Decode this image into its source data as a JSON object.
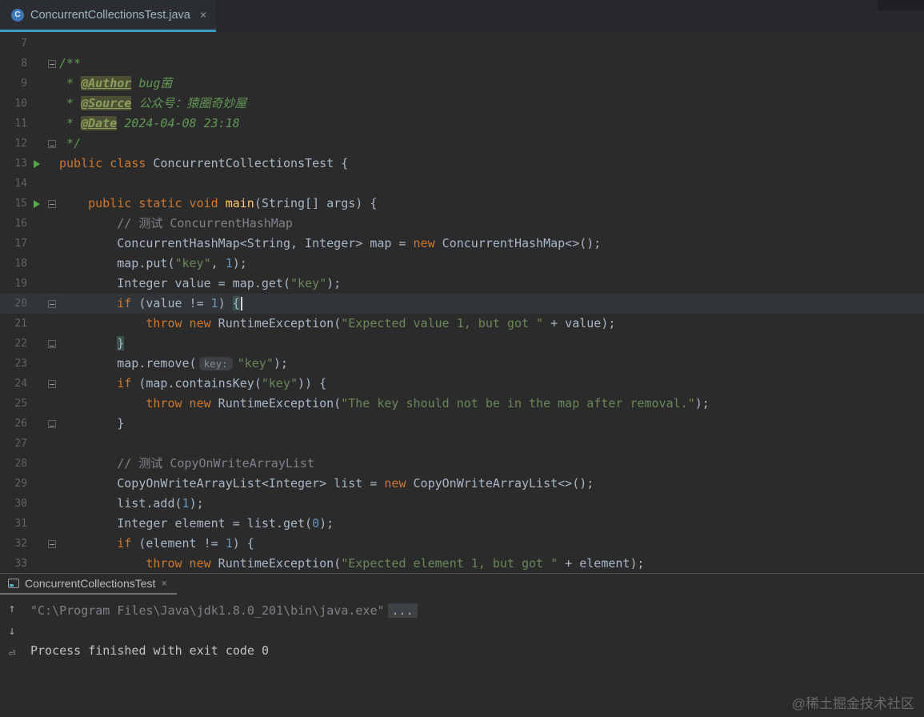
{
  "editor": {
    "tab": {
      "icon": "C",
      "label": "ConcurrentCollectionsTest.java",
      "close": "×"
    },
    "lines": [
      {
        "n": "7",
        "g": "",
        "seg": []
      },
      {
        "n": "8",
        "g": "fold",
        "seg": [
          {
            "s": "d",
            "t": "/**"
          }
        ]
      },
      {
        "n": "9",
        "g": "",
        "seg": [
          {
            "s": "d",
            "t": " * "
          },
          {
            "s": "t",
            "t": "@Author"
          },
          {
            "s": "v",
            "t": " bug菌"
          }
        ]
      },
      {
        "n": "10",
        "g": "",
        "seg": [
          {
            "s": "d",
            "t": " * "
          },
          {
            "s": "t",
            "t": "@Source"
          },
          {
            "s": "v",
            "t": " 公众号：猿圈奇妙屋"
          }
        ]
      },
      {
        "n": "11",
        "g": "",
        "seg": [
          {
            "s": "d",
            "t": " * "
          },
          {
            "s": "t",
            "t": "@Date"
          },
          {
            "s": "v",
            "t": " 2024-04-08 23:18"
          }
        ]
      },
      {
        "n": "12",
        "g": "foldend",
        "seg": [
          {
            "s": "d",
            "t": " */"
          }
        ]
      },
      {
        "n": "13",
        "g": "run",
        "seg": [
          {
            "s": "k",
            "t": "public class "
          },
          {
            "s": "p",
            "t": "ConcurrentCollectionsTest {"
          }
        ]
      },
      {
        "n": "14",
        "g": "",
        "seg": []
      },
      {
        "n": "15",
        "g": "runfold",
        "seg": [
          {
            "s": "p",
            "t": "    "
          },
          {
            "s": "k",
            "t": "public static void "
          },
          {
            "s": "m",
            "t": "main"
          },
          {
            "s": "p",
            "t": "(String[] args) {"
          }
        ]
      },
      {
        "n": "16",
        "g": "",
        "seg": [
          {
            "s": "p",
            "t": "        "
          },
          {
            "s": "c",
            "t": "// 测试 ConcurrentHashMap"
          }
        ]
      },
      {
        "n": "17",
        "g": "",
        "seg": [
          {
            "s": "p",
            "t": "        ConcurrentHashMap<String, Integer> map = "
          },
          {
            "s": "k",
            "t": "new"
          },
          {
            "s": "p",
            "t": " ConcurrentHashMap<>();"
          }
        ]
      },
      {
        "n": "18",
        "g": "",
        "seg": [
          {
            "s": "p",
            "t": "        map.put("
          },
          {
            "s": "s",
            "t": "\"key\""
          },
          {
            "s": "p",
            "t": ", "
          },
          {
            "s": "num",
            "t": "1"
          },
          {
            "s": "p",
            "t": ");"
          }
        ]
      },
      {
        "n": "19",
        "g": "",
        "seg": [
          {
            "s": "p",
            "t": "        Integer value = map.get("
          },
          {
            "s": "s",
            "t": "\"key\""
          },
          {
            "s": "p",
            "t": ");"
          }
        ]
      },
      {
        "n": "20",
        "g": "fold",
        "cur": true,
        "caret": true,
        "seg": [
          {
            "s": "p",
            "t": "        "
          },
          {
            "s": "k",
            "t": "if"
          },
          {
            "s": "p",
            "t": " (value != "
          },
          {
            "s": "num",
            "t": "1"
          },
          {
            "s": "p",
            "t": ") "
          },
          {
            "s": "b",
            "t": "{"
          }
        ]
      },
      {
        "n": "21",
        "g": "",
        "seg": [
          {
            "s": "p",
            "t": "            "
          },
          {
            "s": "k",
            "t": "throw new"
          },
          {
            "s": "p",
            "t": " RuntimeException("
          },
          {
            "s": "s",
            "t": "\"Expected value 1, but got \""
          },
          {
            "s": "p",
            "t": " + value);"
          }
        ]
      },
      {
        "n": "22",
        "g": "foldend",
        "seg": [
          {
            "s": "p",
            "t": "        "
          },
          {
            "s": "b",
            "t": "}"
          }
        ]
      },
      {
        "n": "23",
        "g": "",
        "seg": [
          {
            "s": "p",
            "t": "        map.remove("
          },
          {
            "s": "i",
            "t": "key:"
          },
          {
            "s": "s",
            "t": "\"key\""
          },
          {
            "s": "p",
            "t": ");"
          }
        ]
      },
      {
        "n": "24",
        "g": "fold",
        "seg": [
          {
            "s": "p",
            "t": "        "
          },
          {
            "s": "k",
            "t": "if"
          },
          {
            "s": "p",
            "t": " (map.containsKey("
          },
          {
            "s": "s",
            "t": "\"key\""
          },
          {
            "s": "p",
            "t": ")) {"
          }
        ]
      },
      {
        "n": "25",
        "g": "",
        "seg": [
          {
            "s": "p",
            "t": "            "
          },
          {
            "s": "k",
            "t": "throw new"
          },
          {
            "s": "p",
            "t": " RuntimeException("
          },
          {
            "s": "s",
            "t": "\"The key should not be in the map after removal.\""
          },
          {
            "s": "p",
            "t": ");"
          }
        ]
      },
      {
        "n": "26",
        "g": "foldend",
        "seg": [
          {
            "s": "p",
            "t": "        }"
          }
        ]
      },
      {
        "n": "27",
        "g": "",
        "seg": []
      },
      {
        "n": "28",
        "g": "",
        "seg": [
          {
            "s": "p",
            "t": "        "
          },
          {
            "s": "c",
            "t": "// 测试 CopyOnWriteArrayList"
          }
        ]
      },
      {
        "n": "29",
        "g": "",
        "seg": [
          {
            "s": "p",
            "t": "        CopyOnWriteArrayList<Integer> list = "
          },
          {
            "s": "k",
            "t": "new"
          },
          {
            "s": "p",
            "t": " CopyOnWriteArrayList<>();"
          }
        ]
      },
      {
        "n": "30",
        "g": "",
        "seg": [
          {
            "s": "p",
            "t": "        list.add("
          },
          {
            "s": "num",
            "t": "1"
          },
          {
            "s": "p",
            "t": ");"
          }
        ]
      },
      {
        "n": "31",
        "g": "",
        "seg": [
          {
            "s": "p",
            "t": "        Integer element = list.get("
          },
          {
            "s": "num",
            "t": "0"
          },
          {
            "s": "p",
            "t": ");"
          }
        ]
      },
      {
        "n": "32",
        "g": "fold",
        "seg": [
          {
            "s": "p",
            "t": "        "
          },
          {
            "s": "k",
            "t": "if"
          },
          {
            "s": "p",
            "t": " (element != "
          },
          {
            "s": "num",
            "t": "1"
          },
          {
            "s": "p",
            "t": ") {"
          }
        ]
      },
      {
        "n": "33",
        "g": "",
        "seg": [
          {
            "s": "p",
            "t": "            "
          },
          {
            "s": "k",
            "t": "throw new"
          },
          {
            "s": "p",
            "t": " RuntimeException("
          },
          {
            "s": "s",
            "t": "\"Expected element 1, but got \""
          },
          {
            "s": "p",
            "t": " + element);"
          }
        ]
      }
    ]
  },
  "console": {
    "tab_label": "ConcurrentCollectionsTest",
    "close": "×",
    "command": "\"C:\\Program Files\\Java\\jdk1.8.0_201\\bin\\java.exe\"",
    "command_fold": "...",
    "result": "Process finished with exit code 0",
    "toolbar": {
      "up": "↑",
      "down": "↓",
      "softwrap": "⏎"
    }
  },
  "colors": {
    "background": "#2b2b2b",
    "keyword": "#cc7832",
    "string": "#6a8759",
    "number": "#6897bb",
    "comment": "#7f8288",
    "doc": "#629755",
    "method": "#ffc66d",
    "tab_underline": "#3a9cbe",
    "run_arrow": "#57a64a"
  },
  "watermark": "@稀土掘金技术社区"
}
